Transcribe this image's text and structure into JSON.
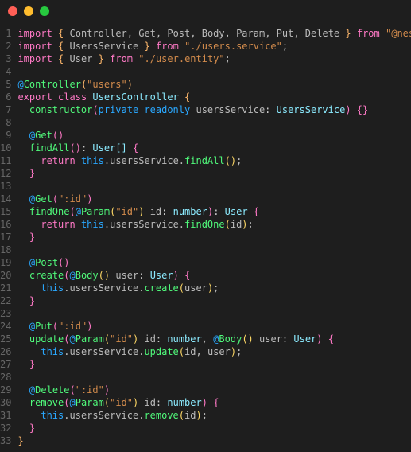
{
  "window": {
    "traffic_lights": [
      "close",
      "minimize",
      "zoom"
    ]
  },
  "editor": {
    "line_count": 33,
    "lines": [
      [
        [
          "kw-import",
          "import"
        ],
        [
          "punct",
          " "
        ],
        [
          "brace",
          "{"
        ],
        [
          "punct",
          " "
        ],
        [
          "ident",
          "Controller"
        ],
        [
          "comma",
          ", "
        ],
        [
          "ident",
          "Get"
        ],
        [
          "comma",
          ", "
        ],
        [
          "ident",
          "Post"
        ],
        [
          "comma",
          ", "
        ],
        [
          "ident",
          "Body"
        ],
        [
          "comma",
          ", "
        ],
        [
          "ident",
          "Param"
        ],
        [
          "comma",
          ", "
        ],
        [
          "ident",
          "Put"
        ],
        [
          "comma",
          ", "
        ],
        [
          "ident",
          "Delete"
        ],
        [
          "punct",
          " "
        ],
        [
          "brace",
          "}"
        ],
        [
          "punct",
          " "
        ],
        [
          "kw-from",
          "from"
        ],
        [
          "punct",
          " "
        ],
        [
          "string",
          "\"@nestjs/common\""
        ],
        [
          "semi",
          ";"
        ]
      ],
      [
        [
          "kw-import",
          "import"
        ],
        [
          "punct",
          " "
        ],
        [
          "brace",
          "{"
        ],
        [
          "punct",
          " "
        ],
        [
          "ident",
          "UsersService"
        ],
        [
          "punct",
          " "
        ],
        [
          "brace",
          "}"
        ],
        [
          "punct",
          " "
        ],
        [
          "kw-from",
          "from"
        ],
        [
          "punct",
          " "
        ],
        [
          "string",
          "\"./users.service\""
        ],
        [
          "semi",
          ";"
        ]
      ],
      [
        [
          "kw-import",
          "import"
        ],
        [
          "punct",
          " "
        ],
        [
          "brace",
          "{"
        ],
        [
          "punct",
          " "
        ],
        [
          "ident",
          "User"
        ],
        [
          "punct",
          " "
        ],
        [
          "brace",
          "}"
        ],
        [
          "punct",
          " "
        ],
        [
          "kw-from",
          "from"
        ],
        [
          "punct",
          " "
        ],
        [
          "string",
          "\"./user.entity\""
        ],
        [
          "semi",
          ";"
        ]
      ],
      [],
      [
        [
          "decorator-at",
          "@"
        ],
        [
          "decorator-name",
          "Controller"
        ],
        [
          "brace",
          "("
        ],
        [
          "string",
          "\"users\""
        ],
        [
          "brace",
          ")"
        ]
      ],
      [
        [
          "kw-export",
          "export"
        ],
        [
          "punct",
          " "
        ],
        [
          "kw-class",
          "class"
        ],
        [
          "punct",
          " "
        ],
        [
          "name-class",
          "UsersController"
        ],
        [
          "punct",
          " "
        ],
        [
          "brace",
          "{"
        ]
      ],
      [
        [
          "punct",
          "  "
        ],
        [
          "name-func",
          "constructor"
        ],
        [
          "brace2",
          "("
        ],
        [
          "kw-private",
          "private"
        ],
        [
          "punct",
          " "
        ],
        [
          "kw-readonly",
          "readonly"
        ],
        [
          "punct",
          " "
        ],
        [
          "param-name",
          "usersService"
        ],
        [
          "punct",
          ": "
        ],
        [
          "name-type",
          "UsersService"
        ],
        [
          "brace2",
          ")"
        ],
        [
          "punct",
          " "
        ],
        [
          "brace2",
          "{}"
        ]
      ],
      [],
      [
        [
          "punct",
          "  "
        ],
        [
          "decorator-at",
          "@"
        ],
        [
          "decorator-name",
          "Get"
        ],
        [
          "brace2",
          "()"
        ]
      ],
      [
        [
          "punct",
          "  "
        ],
        [
          "name-method",
          "findAll"
        ],
        [
          "brace2",
          "()"
        ],
        [
          "punct",
          ": "
        ],
        [
          "name-type",
          "User"
        ],
        [
          "bracket",
          "[]"
        ],
        [
          "punct",
          " "
        ],
        [
          "brace2",
          "{"
        ]
      ],
      [
        [
          "punct",
          "    "
        ],
        [
          "kw-return",
          "return"
        ],
        [
          "punct",
          " "
        ],
        [
          "kw-this",
          "this"
        ],
        [
          "dot",
          "."
        ],
        [
          "ident",
          "usersService"
        ],
        [
          "dot",
          "."
        ],
        [
          "name-method",
          "findAll"
        ],
        [
          "paren2",
          "()"
        ],
        [
          "semi",
          ";"
        ]
      ],
      [
        [
          "punct",
          "  "
        ],
        [
          "brace2",
          "}"
        ]
      ],
      [],
      [
        [
          "punct",
          "  "
        ],
        [
          "decorator-at",
          "@"
        ],
        [
          "decorator-name",
          "Get"
        ],
        [
          "brace2",
          "("
        ],
        [
          "string",
          "\":id\""
        ],
        [
          "brace2",
          ")"
        ]
      ],
      [
        [
          "punct",
          "  "
        ],
        [
          "name-method",
          "findOne"
        ],
        [
          "brace2",
          "("
        ],
        [
          "decorator-at",
          "@"
        ],
        [
          "decorator-name",
          "Param"
        ],
        [
          "paren2",
          "("
        ],
        [
          "string",
          "\"id\""
        ],
        [
          "paren2",
          ")"
        ],
        [
          "punct",
          " "
        ],
        [
          "param-name",
          "id"
        ],
        [
          "punct",
          ": "
        ],
        [
          "name-type",
          "number"
        ],
        [
          "brace2",
          ")"
        ],
        [
          "punct",
          ": "
        ],
        [
          "name-type",
          "User"
        ],
        [
          "punct",
          " "
        ],
        [
          "brace2",
          "{"
        ]
      ],
      [
        [
          "punct",
          "    "
        ],
        [
          "kw-return",
          "return"
        ],
        [
          "punct",
          " "
        ],
        [
          "kw-this",
          "this"
        ],
        [
          "dot",
          "."
        ],
        [
          "ident",
          "usersService"
        ],
        [
          "dot",
          "."
        ],
        [
          "name-method",
          "findOne"
        ],
        [
          "paren2",
          "("
        ],
        [
          "ident",
          "id"
        ],
        [
          "paren2",
          ")"
        ],
        [
          "semi",
          ";"
        ]
      ],
      [
        [
          "punct",
          "  "
        ],
        [
          "brace2",
          "}"
        ]
      ],
      [],
      [
        [
          "punct",
          "  "
        ],
        [
          "decorator-at",
          "@"
        ],
        [
          "decorator-name",
          "Post"
        ],
        [
          "brace2",
          "()"
        ]
      ],
      [
        [
          "punct",
          "  "
        ],
        [
          "name-method",
          "create"
        ],
        [
          "brace2",
          "("
        ],
        [
          "decorator-at",
          "@"
        ],
        [
          "decorator-name",
          "Body"
        ],
        [
          "paren2",
          "()"
        ],
        [
          "punct",
          " "
        ],
        [
          "param-name",
          "user"
        ],
        [
          "punct",
          ": "
        ],
        [
          "name-type",
          "User"
        ],
        [
          "brace2",
          ")"
        ],
        [
          "punct",
          " "
        ],
        [
          "brace2",
          "{"
        ]
      ],
      [
        [
          "punct",
          "    "
        ],
        [
          "kw-this",
          "this"
        ],
        [
          "dot",
          "."
        ],
        [
          "ident",
          "usersService"
        ],
        [
          "dot",
          "."
        ],
        [
          "name-method",
          "create"
        ],
        [
          "paren2",
          "("
        ],
        [
          "ident",
          "user"
        ],
        [
          "paren2",
          ")"
        ],
        [
          "semi",
          ";"
        ]
      ],
      [
        [
          "punct",
          "  "
        ],
        [
          "brace2",
          "}"
        ]
      ],
      [],
      [
        [
          "punct",
          "  "
        ],
        [
          "decorator-at",
          "@"
        ],
        [
          "decorator-name",
          "Put"
        ],
        [
          "brace2",
          "("
        ],
        [
          "string",
          "\":id\""
        ],
        [
          "brace2",
          ")"
        ]
      ],
      [
        [
          "punct",
          "  "
        ],
        [
          "name-method",
          "update"
        ],
        [
          "brace2",
          "("
        ],
        [
          "decorator-at",
          "@"
        ],
        [
          "decorator-name",
          "Param"
        ],
        [
          "paren2",
          "("
        ],
        [
          "string",
          "\"id\""
        ],
        [
          "paren2",
          ")"
        ],
        [
          "punct",
          " "
        ],
        [
          "param-name",
          "id"
        ],
        [
          "punct",
          ": "
        ],
        [
          "name-type",
          "number"
        ],
        [
          "comma",
          ", "
        ],
        [
          "decorator-at",
          "@"
        ],
        [
          "decorator-name",
          "Body"
        ],
        [
          "paren2",
          "()"
        ],
        [
          "punct",
          " "
        ],
        [
          "param-name",
          "user"
        ],
        [
          "punct",
          ": "
        ],
        [
          "name-type",
          "User"
        ],
        [
          "brace2",
          ")"
        ],
        [
          "punct",
          " "
        ],
        [
          "brace2",
          "{"
        ]
      ],
      [
        [
          "punct",
          "    "
        ],
        [
          "kw-this",
          "this"
        ],
        [
          "dot",
          "."
        ],
        [
          "ident",
          "usersService"
        ],
        [
          "dot",
          "."
        ],
        [
          "name-method",
          "update"
        ],
        [
          "paren2",
          "("
        ],
        [
          "ident",
          "id"
        ],
        [
          "comma",
          ", "
        ],
        [
          "ident",
          "user"
        ],
        [
          "paren2",
          ")"
        ],
        [
          "semi",
          ";"
        ]
      ],
      [
        [
          "punct",
          "  "
        ],
        [
          "brace2",
          "}"
        ]
      ],
      [],
      [
        [
          "punct",
          "  "
        ],
        [
          "decorator-at",
          "@"
        ],
        [
          "decorator-name",
          "Delete"
        ],
        [
          "brace2",
          "("
        ],
        [
          "string",
          "\":id\""
        ],
        [
          "brace2",
          ")"
        ]
      ],
      [
        [
          "punct",
          "  "
        ],
        [
          "name-method",
          "remove"
        ],
        [
          "brace2",
          "("
        ],
        [
          "decorator-at",
          "@"
        ],
        [
          "decorator-name",
          "Param"
        ],
        [
          "paren2",
          "("
        ],
        [
          "string",
          "\"id\""
        ],
        [
          "paren2",
          ")"
        ],
        [
          "punct",
          " "
        ],
        [
          "param-name",
          "id"
        ],
        [
          "punct",
          ": "
        ],
        [
          "name-type",
          "number"
        ],
        [
          "brace2",
          ")"
        ],
        [
          "punct",
          " "
        ],
        [
          "brace2",
          "{"
        ]
      ],
      [
        [
          "punct",
          "    "
        ],
        [
          "kw-this",
          "this"
        ],
        [
          "dot",
          "."
        ],
        [
          "ident",
          "usersService"
        ],
        [
          "dot",
          "."
        ],
        [
          "name-method",
          "remove"
        ],
        [
          "paren2",
          "("
        ],
        [
          "ident",
          "id"
        ],
        [
          "paren2",
          ")"
        ],
        [
          "semi",
          ";"
        ]
      ],
      [
        [
          "punct",
          "  "
        ],
        [
          "brace2",
          "}"
        ]
      ],
      [
        [
          "brace",
          "}"
        ]
      ]
    ]
  }
}
